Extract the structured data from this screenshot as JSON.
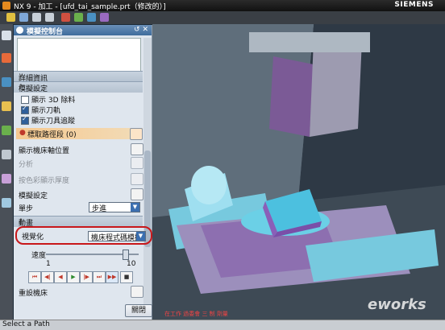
{
  "window": {
    "title": "NX 9 - 加工 - [ufd_tai_sample.prt（修改的）]",
    "brand": "SIEMENS"
  },
  "panel": {
    "title": "模擬控制台",
    "sections": {
      "details": "詳細資訊",
      "settings": "模擬設定",
      "animation": "動畫"
    },
    "checkboxes": [
      {
        "label": "顯示 3D 除料",
        "checked": false
      },
      {
        "label": "顯示刀軌",
        "checked": true
      },
      {
        "label": "顯示刀具追蹤",
        "checked": true
      }
    ],
    "highlight_row": "標取路徑段 (0)",
    "rows": {
      "machine_axes": "顯示機床軸位置",
      "analysis": "分析",
      "color_thickness": "按色彩顯示厚度",
      "sim_settings": "模擬設定",
      "step_label": "單步",
      "step_value": "步進",
      "visualize_label": "視覺化",
      "visualize_value": "機床程式碼模擬",
      "speed_label": "速度",
      "speed_min": "1",
      "speed_max": "10",
      "reset": "重設機床"
    },
    "speed_level": 8,
    "close_button": "關閉"
  },
  "status": {
    "text": "Select a Path"
  },
  "viewport": {
    "red_text": "在工作 過委會 三 制 劑量",
    "watermark": "eworks"
  },
  "colors": {
    "purple": "#7b5a96",
    "cyan": "#4fc6e0",
    "accent": "#c8171a"
  }
}
